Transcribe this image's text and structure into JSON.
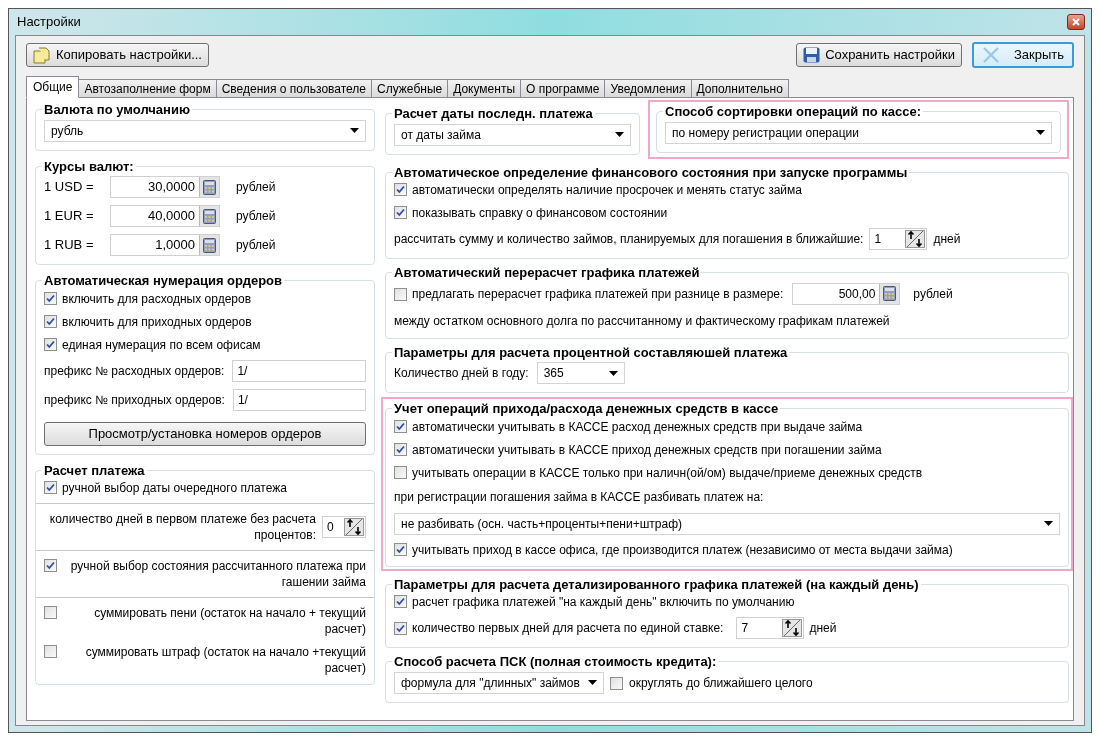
{
  "window": {
    "title": "Настройки"
  },
  "toolbar": {
    "copy_button": "Копировать настройки...",
    "save_button": "Сохранить настройки",
    "close_button": "Закрыть"
  },
  "tabs": [
    {
      "label": "Общие",
      "selected": true
    },
    {
      "label": "Автозаполнение форм",
      "selected": false
    },
    {
      "label": "Сведения о пользователе",
      "selected": false
    },
    {
      "label": "Служебные",
      "selected": false
    },
    {
      "label": "Документы",
      "selected": false
    },
    {
      "label": "О программе",
      "selected": false
    },
    {
      "label": "Уведомления",
      "selected": false
    },
    {
      "label": "Дополнительно",
      "selected": false
    }
  ],
  "left_groups": [
    {
      "title": "Валюта по умолчанию",
      "items": [
        {
          "kind": "dropdown",
          "value": "рубль"
        }
      ]
    },
    {
      "title": "Курсы валют:",
      "items": [
        {
          "kind": "rate",
          "label": "1 USD =",
          "value": "30,0000",
          "unit": "рублей"
        },
        {
          "kind": "rate",
          "label": "1 EUR =",
          "value": "40,0000",
          "unit": "рублей"
        },
        {
          "kind": "rate",
          "label": "1 RUB =",
          "value": "1,0000",
          "unit": "рублей"
        }
      ]
    },
    {
      "title": "Автоматическая нумерация ордеров",
      "items": [
        {
          "kind": "checkbox",
          "label": "включить для расходных ордеров",
          "checked": true
        },
        {
          "kind": "checkbox",
          "label": "включить для приходных ордеров",
          "checked": true
        },
        {
          "kind": "checkbox",
          "label": "единая нумерация по всем офисам",
          "checked": true
        },
        {
          "kind": "prefix",
          "label": "префикс № расходных ордеров:",
          "value": "1/"
        },
        {
          "kind": "prefix",
          "label": "префикс № приходных ордеров:",
          "value": "1/"
        },
        {
          "kind": "button",
          "label": "Просмотр/установка номеров ордеров"
        }
      ]
    },
    {
      "title": "Расчет платежа",
      "items": [
        {
          "kind": "checkbox",
          "label": "ручной выбор даты очередного платежа",
          "checked": true
        },
        {
          "kind": "divider"
        },
        {
          "kind": "spin",
          "label": "количество дней в первом платеже без расчета процентов:",
          "value": "0"
        },
        {
          "kind": "divider"
        },
        {
          "kind": "checkbox",
          "label": "ручной выбор состояния рассчитанного платежа при гашении займа",
          "checked": true
        },
        {
          "kind": "divider"
        },
        {
          "kind": "checkbox",
          "label": "суммировать пени (остаток на начало + текущий расчет)",
          "checked": false
        },
        {
          "kind": "checkbox",
          "label": "суммировать штраф (остаток на начало +текущий расчет)",
          "checked": false
        }
      ]
    }
  ],
  "right_top_groups": [
    {
      "title": "Расчет даты последн. платежа",
      "items": [
        {
          "kind": "dropdown",
          "value": "от даты займа"
        }
      ]
    },
    {
      "title": "Способ сортировки операций по кассе:",
      "items": [
        {
          "kind": "dropdown",
          "value": "по номеру регистрации операции"
        }
      ]
    }
  ],
  "right_groups": [
    {
      "title": "Автоматическое определение финансового состояния при запуске программы",
      "items": [
        {
          "kind": "checkbox",
          "label": "автоматически определять наличие просрочек и менять статус займа",
          "checked": true
        },
        {
          "kind": "checkbox",
          "label": "показывать справку о финансовом состоянии",
          "checked": true
        },
        {
          "kind": "spin",
          "label": "рассчитать сумму и количество займов, планируемых для  погашения в ближайшие:",
          "value": "1",
          "unit": "дней"
        }
      ]
    },
    {
      "title": "Автоматический перерасчет графика платежей",
      "items": [
        {
          "kind": "check_amount",
          "label": "предлагать перерасчет графика платежей при разнице в размере:",
          "checked": false,
          "value": "500,00",
          "unit": "рублей"
        },
        {
          "kind": "text",
          "label": "между остатком основного долга по рассчитанному и фактическому графикам платежей"
        }
      ]
    },
    {
      "title": "Параметры для расчета процентной составляюшей платежа",
      "items": [
        {
          "kind": "labeled_dropdown",
          "label": "Количество дней в году:",
          "value": "365"
        }
      ]
    },
    {
      "title": "Учет операций прихода/расхода денежных средств в кассе",
      "items": [
        {
          "kind": "checkbox",
          "label": "автоматически учитывать в КАССЕ расход денежных средств при выдаче займа",
          "checked": true
        },
        {
          "kind": "checkbox",
          "label": "автоматически учитывать в КАССЕ приход денежных средств при погашении займа",
          "checked": true
        },
        {
          "kind": "checkbox",
          "label": "учитывать операции в КАССЕ только при наличн(ой/ом) выдаче/приеме денежных средств",
          "checked": false
        },
        {
          "kind": "text",
          "label": "при регистрации погашения займа в КАССЕ разбивать платеж на:"
        },
        {
          "kind": "dropdown",
          "value": "не разбивать (осн. часть+проценты+пени+штраф)"
        },
        {
          "kind": "checkbox",
          "label": "учитывать приход в кассе офиса, где производится платеж (независимо от места выдачи займа)",
          "checked": true
        }
      ]
    },
    {
      "title": "Параметры для расчета детализированного графика платежей (на каждый день)",
      "items": [
        {
          "kind": "checkbox",
          "label": "расчет графика платежей \"на каждый день\" включить по умолчанию",
          "checked": true
        },
        {
          "kind": "check_spin",
          "label": "количество первых дней для расчета по единой ставке:",
          "checked": true,
          "value": "7",
          "unit": "дней"
        }
      ]
    },
    {
      "title": "Способ расчета ПСК (полная стоимость кредита):",
      "items": [
        {
          "kind": "dropdown_check",
          "value": "формула для \"длинных\" займов",
          "label": "округлять до ближайшего целого",
          "checked": false
        }
      ]
    }
  ]
}
